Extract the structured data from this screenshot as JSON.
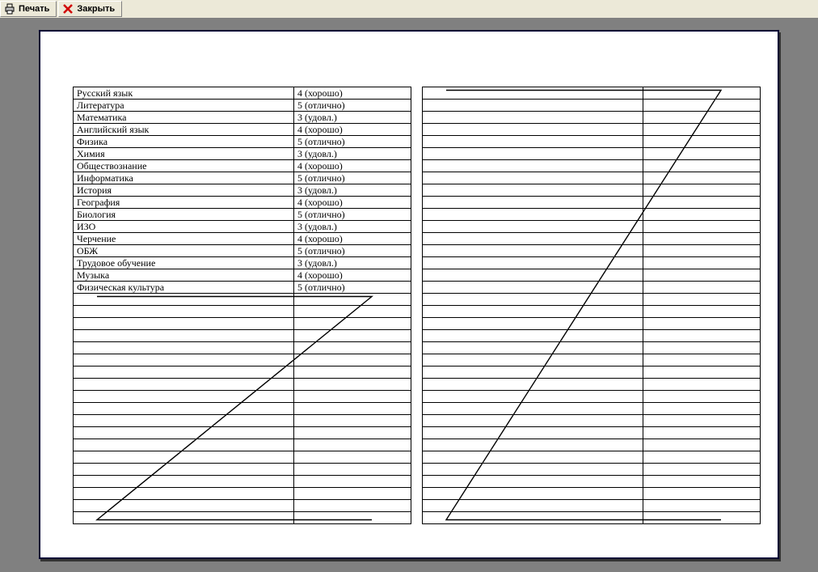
{
  "toolbar": {
    "print_label": "Печать",
    "close_label": "Закрыть"
  },
  "layout": {
    "rows_per_leaf": 36
  },
  "left_leaf": {
    "rows": [
      {
        "subject": "Русский язык",
        "grade": "4 (хорошо)"
      },
      {
        "subject": "Литература",
        "grade": "5 (отлично)"
      },
      {
        "subject": "Математика",
        "grade": "3 (удовл.)"
      },
      {
        "subject": "Английский язык",
        "grade": "4 (хорошо)"
      },
      {
        "subject": "Физика",
        "grade": "5 (отлично)"
      },
      {
        "subject": "Химия",
        "grade": "3 (удовл.)"
      },
      {
        "subject": "Обществознание",
        "grade": "4 (хорошо)"
      },
      {
        "subject": "Информатика",
        "grade": "5 (отлично)"
      },
      {
        "subject": "История",
        "grade": "3 (удовл.)"
      },
      {
        "subject": "География",
        "grade": "4 (хорошо)"
      },
      {
        "subject": "Биология",
        "grade": "5 (отлично)"
      },
      {
        "subject": "ИЗО",
        "grade": "3 (удовл.)"
      },
      {
        "subject": "Черчение",
        "grade": "4 (хорошо)"
      },
      {
        "subject": "ОБЖ",
        "grade": "5 (отлично)"
      },
      {
        "subject": "Трудовое обучение",
        "grade": "3 (удовл.)"
      },
      {
        "subject": "Музыка",
        "grade": "4 (хорошо)"
      },
      {
        "subject": "Физическая культура",
        "grade": "5 (отлично)"
      }
    ],
    "z_start_row": 17
  },
  "right_leaf": {
    "rows": [],
    "z_start_row": 0
  }
}
